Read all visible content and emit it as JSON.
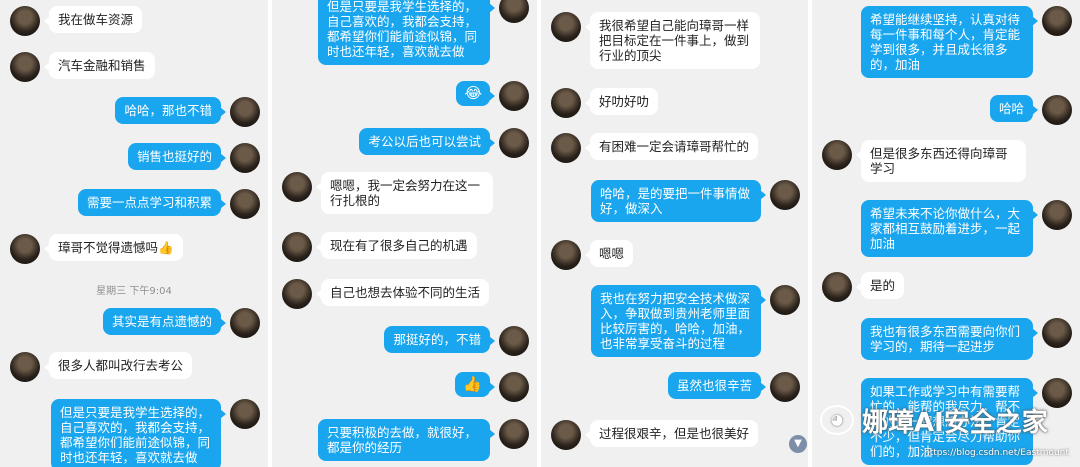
{
  "panel1": {
    "messages": [
      {
        "side": "left",
        "text": "我在做车资源"
      },
      {
        "side": "left",
        "text": "汽车金融和销售"
      },
      {
        "side": "right",
        "text": "哈哈，那也不错"
      },
      {
        "side": "right",
        "text": "销售也挺好的"
      },
      {
        "side": "right",
        "text": "需要一点点学习和积累"
      },
      {
        "side": "left",
        "text": "璋哥不觉得遗憾吗👍"
      },
      {
        "side": "right",
        "text": "其实是有点遗憾的"
      },
      {
        "side": "left",
        "text": "很多人都叫改行去考公"
      },
      {
        "side": "right",
        "text": "但是只要是我学生选择的，自己喜欢的，我都会支持，都希望你们能前途似锦，同时也还年轻，喜欢就去做"
      }
    ],
    "timestamp": "星期三 下午9:04"
  },
  "panel2": {
    "messages": [
      {
        "side": "right",
        "text": "但是只要是我学生选择的，自己喜欢的，我都会支持，都希望你们能前途似锦，同时也还年轻，喜欢就去做"
      },
      {
        "side": "right",
        "text": "😂"
      },
      {
        "side": "right",
        "text": "考公以后也可以尝试"
      },
      {
        "side": "left",
        "text": "嗯嗯，我一定会努力在这一行扎根的"
      },
      {
        "side": "left",
        "text": "现在有了很多自己的机遇"
      },
      {
        "side": "left",
        "text": "自己也想去体验不同的生活"
      },
      {
        "side": "right",
        "text": "那挺好的，不错"
      },
      {
        "side": "right",
        "text": "👍"
      },
      {
        "side": "right",
        "text": "只要积极的去做，就很好，都是你的经历"
      }
    ]
  },
  "panel3": {
    "messages": [
      {
        "side": "left",
        "text": "我很希望自己能向璋哥一样把目标定在一件事上，做到行业的顶尖"
      },
      {
        "side": "left",
        "text": "好叻好叻"
      },
      {
        "side": "left",
        "text": "有困难一定会请璋哥帮忙的"
      },
      {
        "side": "right",
        "text": "哈哈，是的要把一件事情做好，做深入"
      },
      {
        "side": "left",
        "text": "嗯嗯"
      },
      {
        "side": "right",
        "text": "我也在努力把安全技术做深入，争取做到贵州老师里面比较厉害的，哈哈，加油，也非常享受奋斗的过程"
      },
      {
        "side": "right",
        "text": "虽然也很辛苦"
      },
      {
        "side": "left",
        "text": "过程很艰辛，但是也很美好"
      }
    ],
    "scroll_icon": "chevron-down-icon"
  },
  "panel4": {
    "messages": [
      {
        "side": "right",
        "text": "希望能继续坚持，认真对待每一件事和每个人，肯定能学到很多，并且成长很多的，加油"
      },
      {
        "side": "right",
        "text": "哈哈"
      },
      {
        "side": "left",
        "text": "但是很多东西还得向璋哥学习"
      },
      {
        "side": "right",
        "text": "希望未来不论你做什么，大家都相互鼓励着进步，一起加油"
      },
      {
        "side": "left",
        "text": "是的"
      },
      {
        "side": "right",
        "text": "我也有很多东西需要向你们学习的，期待一起进步"
      },
      {
        "side": "right",
        "text": "如果工作或学习中有需要帮忙的，能帮的我尽力，帮不了的也一起想想办法，肯定不少，但肯定会尽力帮助你们的，加油"
      }
    ]
  },
  "watermark": {
    "brand": "娜璋AI安全之家",
    "url": "https://blog.csdn.net/Eastmount"
  },
  "colors": {
    "outgoing": "#1aa6ee",
    "incoming": "#ffffff",
    "background": "#f0f0f0"
  }
}
